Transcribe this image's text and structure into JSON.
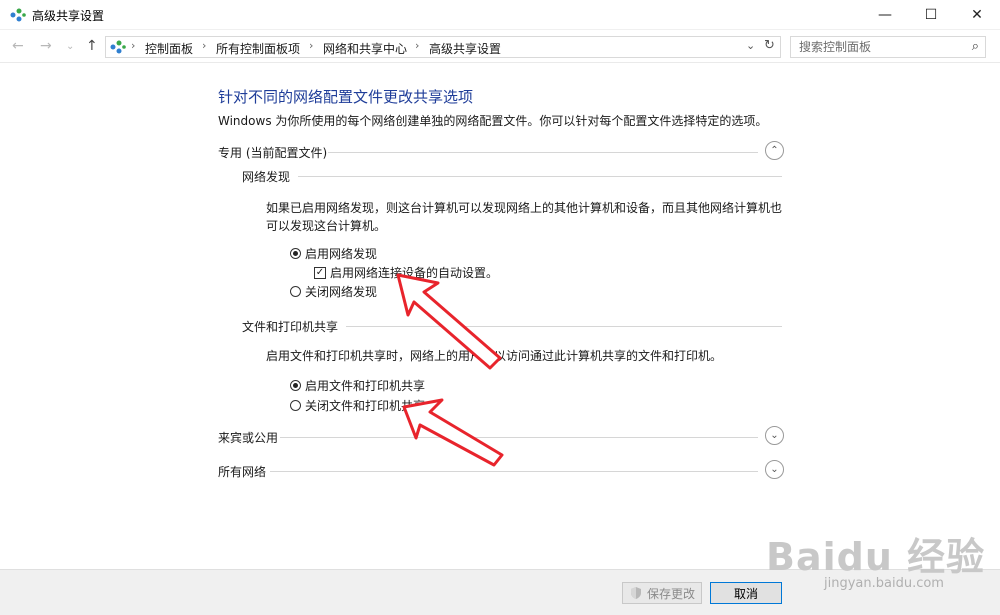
{
  "window": {
    "title": "高级共享设置",
    "min_glyph": "—",
    "max_glyph": "☐",
    "close_glyph": "✕"
  },
  "nav": {
    "back_glyph": "←",
    "forward_glyph": "→",
    "history_glyph": "⌄",
    "up_glyph": "↑",
    "breadcrumbs": [
      "控制面板",
      "所有控制面板项",
      "网络和共享中心",
      "高级共享设置"
    ],
    "separator": "›",
    "dropdown_glyph": "⌄",
    "refresh_glyph": "↻",
    "search_placeholder": "搜索控制面板",
    "search_glyph": "⌕"
  },
  "content": {
    "heading": "针对不同的网络配置文件更改共享选项",
    "description": "Windows 为你所使用的每个网络创建单独的网络配置文件。你可以针对每个配置文件选择特定的选项。",
    "private_profile": {
      "label": "专用 (当前配置文件)",
      "expanded": true,
      "network_discovery": {
        "label": "网络发现",
        "text": "如果已启用网络发现，则这台计算机可以发现网络上的其他计算机和设备，而且其他网络计算机也可以发现这台计算机。",
        "option_on": "启用网络发现",
        "option_on_selected": true,
        "auto_setup": "启用网络连接设备的自动设置。",
        "auto_setup_checked": true,
        "option_off": "关闭网络发现"
      },
      "file_sharing": {
        "label": "文件和打印机共享",
        "text": "启用文件和打印机共享时，网络上的用户可以访问通过此计算机共享的文件和打印机。",
        "option_on": "启用文件和打印机共享",
        "option_on_selected": true,
        "option_off": "关闭文件和打印机共享"
      }
    },
    "guest_public": {
      "label": "来宾或公用",
      "expanded": false
    },
    "all_networks": {
      "label": "所有网络",
      "expanded": false
    },
    "chevron_up": "⌃",
    "chevron_down": "⌄"
  },
  "footer": {
    "save_label": "保存更改",
    "cancel_label": "取消"
  },
  "watermark": {
    "brand": "Baidu 经验",
    "url": "jingyan.baidu.com"
  },
  "colors": {
    "heading": "#1f3d99",
    "arrow": "#e8242c",
    "cancel_border": "#0078d7"
  }
}
